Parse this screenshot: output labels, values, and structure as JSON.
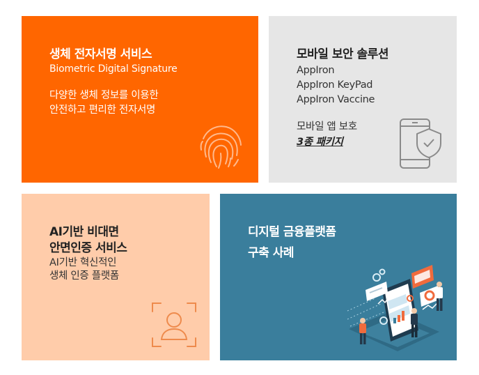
{
  "cards": [
    {
      "title": "생체 전자서명 서비스",
      "subtitle": "Biometric Digital Signature",
      "desc_lines": [
        "다양한 생체 정보를 이용한",
        "안전하고 편리한 전자서명"
      ],
      "icon": "fingerprint-icon",
      "bg": "#ff6600"
    },
    {
      "title": "모바일 보안 솔루션",
      "products": [
        "AppIron",
        "AppIron KeyPad",
        "AppIron Vaccine"
      ],
      "note": "모바일 앱 보호",
      "package_link": "3종 패키지",
      "icon": "mobile-shield-icon",
      "bg": "#e6e6e6"
    },
    {
      "title_lines": [
        "AI기반 비대면",
        "안면인증 서비스"
      ],
      "desc_lines": [
        "AI기반 혁신적인",
        "생체 인증 플랫폼"
      ],
      "icon": "face-scan-icon",
      "bg": "#ffccaa"
    },
    {
      "title_lines": [
        "디지털 금융플랫폼",
        "구축 사례"
      ],
      "illustration": "digital-platform-illustration",
      "bg": "#3a7e9c"
    }
  ]
}
